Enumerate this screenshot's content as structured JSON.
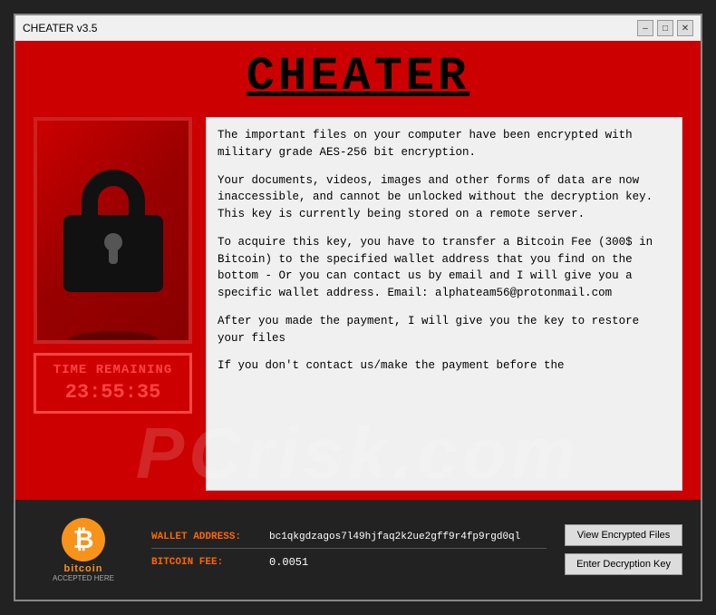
{
  "titlebar": {
    "title": "CHEATER v3.5",
    "minimize": "–",
    "maximize": "□",
    "close": "✕"
  },
  "header": {
    "title": "CHEATER"
  },
  "ransom_text": {
    "paragraph1": "The important files on your computer have been encrypted with military grade AES-256 bit encryption.",
    "paragraph2": "Your documents, videos, images and other forms of data are now inaccessible, and cannot be unlocked without the decryption key. This key is currently being stored on a remote server.",
    "paragraph3": "To acquire this key, you have to transfer a Bitcoin Fee (300$ in Bitcoin) to the specified wallet address that you find on the bottom - Or you can contact us by email and I will give you a specific wallet address. Email: alphateam56@protonmail.com",
    "paragraph4": "After you made the payment, I will give you the key to restore your files",
    "paragraph5": "If you don't contact us/make the payment before the"
  },
  "timer": {
    "label": "TIME REMAINING",
    "value": "23:55:35"
  },
  "bitcoin": {
    "symbol": "₿",
    "name": "bitcoin",
    "subtext": "ACCEPTED HERE"
  },
  "wallet": {
    "address_label": "WALLET ADDRESS:",
    "address_value": "bc1qkgdzagos7l49hjfaq2k2ue2gff9r4fp9rgd0ql",
    "fee_label": "BITCOIN FEE:",
    "fee_value": "0.0051"
  },
  "buttons": {
    "view_files": "View Encrypted Files",
    "enter_key": "Enter Decryption Key"
  },
  "watermark": {
    "text": "PCrisk.com"
  }
}
